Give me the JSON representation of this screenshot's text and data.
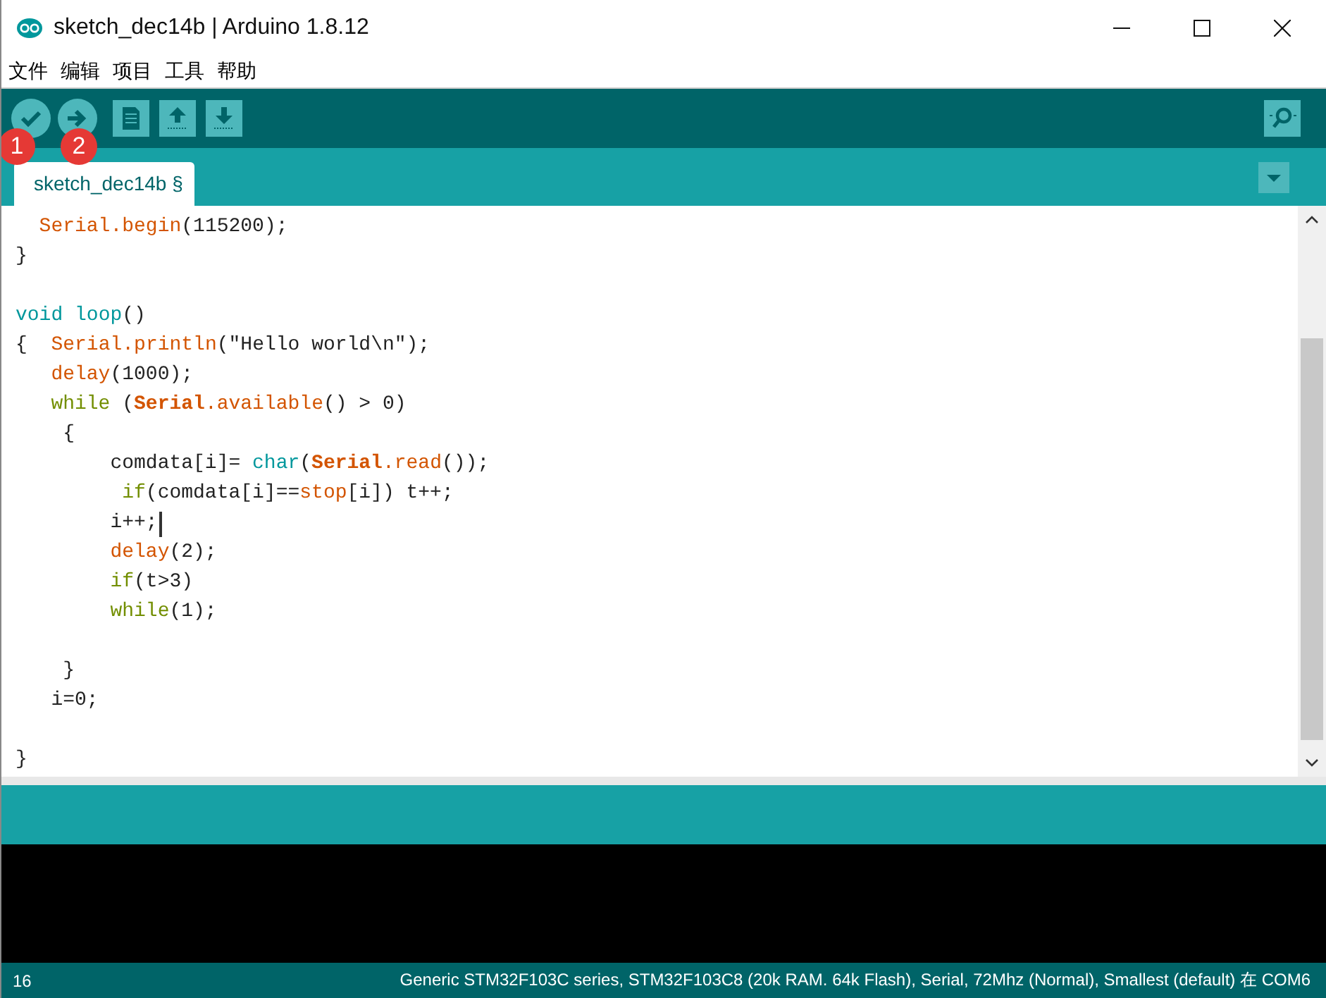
{
  "window": {
    "title": "sketch_dec14b | Arduino 1.8.12"
  },
  "menu": [
    "文件",
    "编辑",
    "项目",
    "工具",
    "帮助"
  ],
  "markers": [
    "1",
    "2"
  ],
  "tabs": [
    {
      "label": "sketch_dec14b §",
      "selected": true
    }
  ],
  "code_lines": [
    {
      "kind": "code",
      "tokens": [
        {
          "kind": "fn",
          "text": "  Serial"
        },
        {
          "kind": "fn",
          "text": ".begin"
        },
        {
          "kind": "plain",
          "text": "(115200);"
        }
      ]
    },
    {
      "kind": "code",
      "tokens": [
        {
          "kind": "plain",
          "text": "}"
        }
      ]
    },
    {
      "kind": "blank"
    },
    {
      "kind": "code",
      "tokens": [
        {
          "kind": "type",
          "text": "void"
        },
        {
          "kind": "type",
          "text": " loop"
        },
        {
          "kind": "plain",
          "text": "()"
        }
      ]
    },
    {
      "kind": "code",
      "tokens": [
        {
          "kind": "plain",
          "text": "{  "
        },
        {
          "kind": "fn",
          "text": "Serial"
        },
        {
          "kind": "fn",
          "text": ".println"
        },
        {
          "kind": "plain",
          "text": "(\"Hello world\\n\");"
        }
      ]
    },
    {
      "kind": "code",
      "tokens": [
        {
          "kind": "fn",
          "text": "   delay"
        },
        {
          "kind": "plain",
          "text": "(1000);"
        }
      ]
    },
    {
      "kind": "code",
      "tokens": [
        {
          "kind": "kw",
          "text": "   while"
        },
        {
          "kind": "plain",
          "text": " ("
        },
        {
          "kind": "fnb",
          "text": "Serial"
        },
        {
          "kind": "fn",
          "text": ".available"
        },
        {
          "kind": "plain",
          "text": "() > 0)"
        }
      ]
    },
    {
      "kind": "code",
      "tokens": [
        {
          "kind": "plain",
          "text": "    {"
        }
      ]
    },
    {
      "kind": "code",
      "tokens": [
        {
          "kind": "plain",
          "text": "        comdata[i]= "
        },
        {
          "kind": "type",
          "text": "char"
        },
        {
          "kind": "plain",
          "text": "("
        },
        {
          "kind": "fnb",
          "text": "Serial"
        },
        {
          "kind": "fn",
          "text": ".read"
        },
        {
          "kind": "plain",
          "text": "());"
        }
      ]
    },
    {
      "kind": "code",
      "tokens": [
        {
          "kind": "kw",
          "text": "         if"
        },
        {
          "kind": "plain",
          "text": "(comdata[i]=="
        },
        {
          "kind": "fn",
          "text": "stop"
        },
        {
          "kind": "plain",
          "text": "[i]) t++;"
        }
      ]
    },
    {
      "kind": "code",
      "tokens": [
        {
          "kind": "plain",
          "text": "        i++;"
        },
        {
          "kind": "caret"
        }
      ]
    },
    {
      "kind": "code",
      "tokens": [
        {
          "kind": "fn",
          "text": "        delay"
        },
        {
          "kind": "plain",
          "text": "(2);"
        }
      ]
    },
    {
      "kind": "code",
      "tokens": [
        {
          "kind": "kw",
          "text": "        if"
        },
        {
          "kind": "plain",
          "text": "(t>3)"
        }
      ]
    },
    {
      "kind": "code",
      "tokens": [
        {
          "kind": "kw",
          "text": "        while"
        },
        {
          "kind": "plain",
          "text": "(1);"
        }
      ]
    },
    {
      "kind": "blank"
    },
    {
      "kind": "code",
      "tokens": [
        {
          "kind": "plain",
          "text": "    }"
        }
      ]
    },
    {
      "kind": "code",
      "tokens": [
        {
          "kind": "plain",
          "text": "   i=0;"
        }
      ]
    },
    {
      "kind": "blank"
    },
    {
      "kind": "code",
      "tokens": [
        {
          "kind": "plain",
          "text": "}"
        }
      ]
    }
  ],
  "status_bar": {
    "line": "16",
    "board": "Generic STM32F103C series, STM32F103C8 (20k RAM. 64k Flash), Serial, 72Mhz (Normal), Smallest (default) 在 COM6"
  }
}
